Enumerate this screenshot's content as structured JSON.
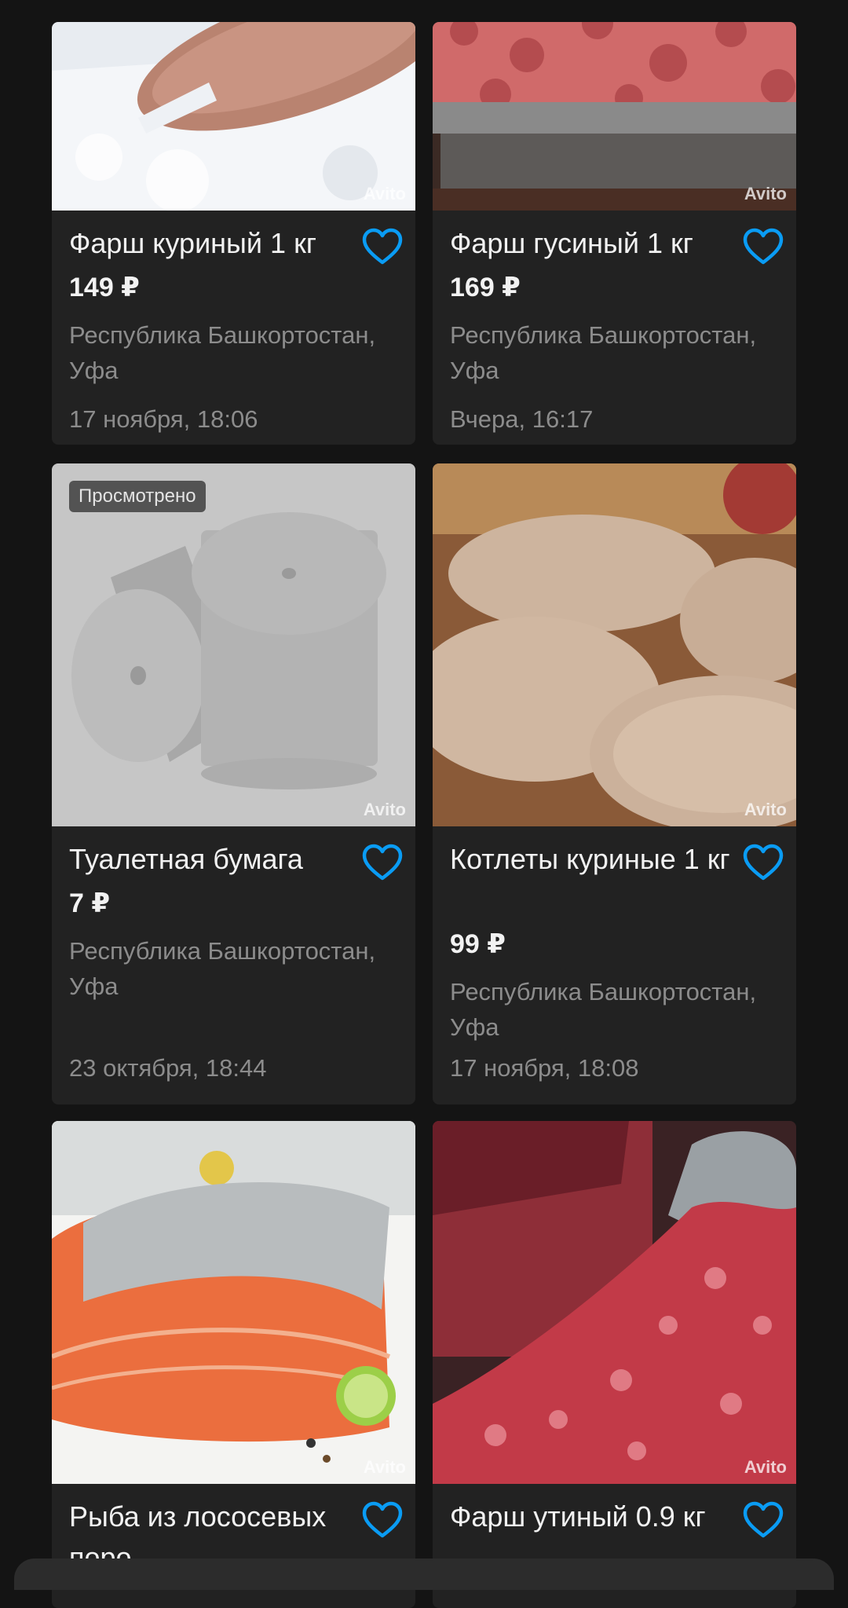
{
  "colors": {
    "background": "#141414",
    "card": "#222222",
    "heart": "#0a9cf4",
    "muted_text": "#8c8c8c"
  },
  "icons": {
    "favorite": "heart-outline-icon"
  },
  "watermark": "Avito",
  "listings": [
    {
      "title": "Фарш куриный 1 кг",
      "price": "149 ₽",
      "location": "Республика Башкортостан, Уфа",
      "date": "17 ноября, 18:06"
    },
    {
      "title": "Фарш гусиный 1 кг",
      "price": "169 ₽",
      "location": "Республика Башкортостан, Уфа",
      "date": "Вчера, 16:17"
    },
    {
      "title": "Туалетная бумага",
      "price": "7 ₽",
      "location": "Республика Башкортостан, Уфа",
      "date": "23 октября, 18:44",
      "badge": "Просмотрено"
    },
    {
      "title": "Котлеты куриные 1 кг",
      "price": "99 ₽",
      "location": "Республика Башкортостан, Уфа",
      "date": "17 ноября, 18:08"
    },
    {
      "title": "Рыба из лососевых поро"
    },
    {
      "title": "Фарш утиный 0.9 кг"
    }
  ]
}
